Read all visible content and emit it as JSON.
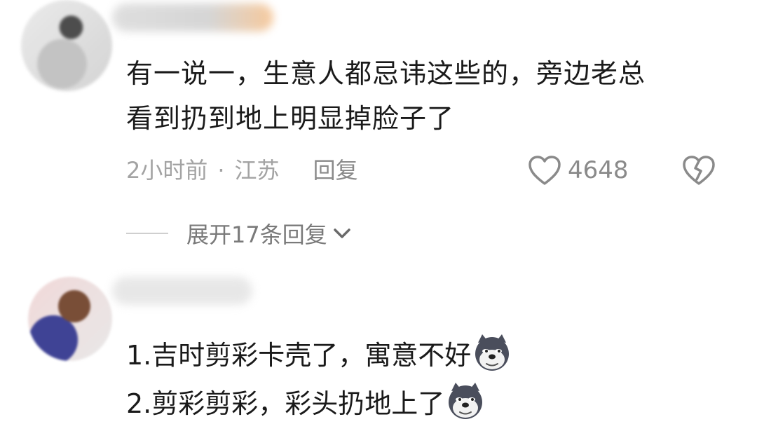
{
  "comment1": {
    "text_lines": [
      "有一说一，生意人都忌讳这些的，旁边老总",
      "看到扔到地上明显掉脸子了"
    ],
    "time": "2小时前",
    "separator": "·",
    "location": "江苏",
    "reply_label": "回复",
    "like_count": "4648",
    "expand_label": "展开17条回复"
  },
  "comment2": {
    "line1": "1.吉时剪彩卡壳了，寓意不好",
    "line2": "2.剪彩剪彩，彩头扔地上了",
    "emoji": "husky-dog-emoji"
  },
  "colors": {
    "text": "#1a1a1a",
    "meta": "#a3a3a3",
    "icon": "#8a8a8a"
  }
}
